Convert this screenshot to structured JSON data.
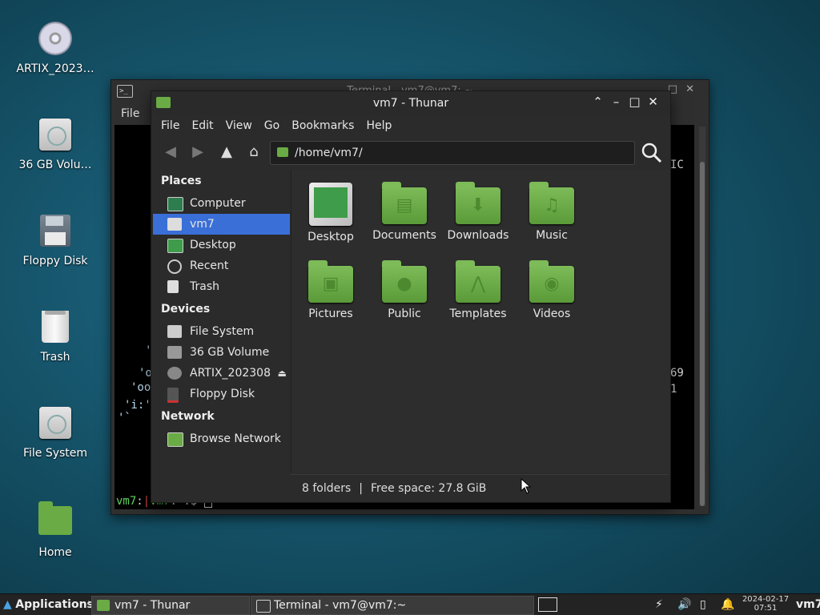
{
  "desktop": {
    "icons": [
      {
        "label": "ARTIX_2023…",
        "icon": "disc-icon"
      },
      {
        "label": "36 GB Volu…",
        "icon": "drive-icon"
      },
      {
        "label": "Floppy Disk",
        "icon": "floppy-icon"
      },
      {
        "label": "Trash",
        "icon": "trash-icon"
      },
      {
        "label": "File System",
        "icon": "drive-icon"
      },
      {
        "label": "Home",
        "icon": "home-folder-icon"
      }
    ]
  },
  "terminal": {
    "title": "Terminal - vm7@vm7: ~",
    "menu_file": "File",
    "lines": [
      {
        "text": "IC"
      },
      {
        "text": "'"
      },
      {
        "text": "'o"
      },
      {
        "text": "'oo"
      },
      {
        "text": "'i:'"
      },
      {
        "text": "'`"
      },
      {
        "text": "69"
      },
      {
        "text": "1"
      }
    ],
    "prompt": {
      "user": "vm7",
      "host": "vm7",
      "path": "~",
      "symbol": "$"
    }
  },
  "thunar": {
    "title": "vm7 - Thunar",
    "menu": [
      "File",
      "Edit",
      "View",
      "Go",
      "Bookmarks",
      "Help"
    ],
    "location": "/home/vm7/",
    "sidebar": {
      "places_heading": "Places",
      "places": [
        "Computer",
        "vm7",
        "Desktop",
        "Recent",
        "Trash"
      ],
      "devices_heading": "Devices",
      "devices": [
        "File System",
        "36 GB Volume",
        "ARTIX_202308",
        "Floppy Disk"
      ],
      "network_heading": "Network",
      "network": [
        "Browse Network"
      ]
    },
    "files": [
      "Desktop",
      "Documents",
      "Downloads",
      "Music",
      "Pictures",
      "Public",
      "Templates",
      "Videos"
    ],
    "status": {
      "folders": "8 folders",
      "separator": "|",
      "free": "Free space: 27.8 GiB"
    }
  },
  "taskbar": {
    "applications": "Applications",
    "tasks": [
      "vm7 - Thunar",
      "Terminal - vm7@vm7:~"
    ],
    "date": "2024-02-17",
    "time": "07:51",
    "user": "vm7"
  },
  "colors": {
    "selection": "#3a6fd8",
    "folder_green": "#6aab45",
    "prompt_green": "#5fd35f",
    "prompt_red": "#e05050"
  }
}
